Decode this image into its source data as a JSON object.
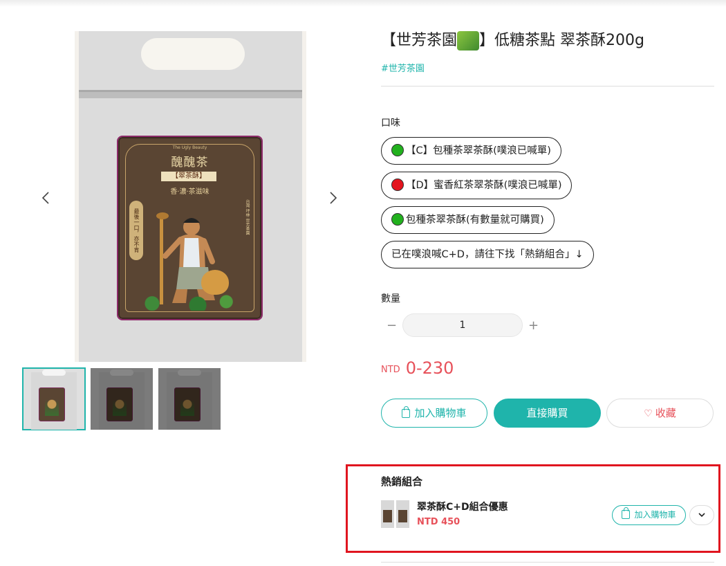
{
  "product": {
    "title_pre": "【世芳茶園",
    "title_post": "】低糖茶點 翠茶酥200g",
    "tag": "#世芳茶園"
  },
  "gallery": {
    "prev_icon": "chevron-left-icon",
    "next_icon": "chevron-right-icon",
    "label": {
      "brand_line": "The Ugly Beauty",
      "name": "醜醜茶",
      "product": "【翠茶酥】",
      "subtitle": "香·濃·茶滋味",
      "left_slogan": "最後一口，亦不肯",
      "right_text": "台灣 坪林 世芳茶園"
    },
    "thumbnails": [
      "thumb-1",
      "thumb-2",
      "thumb-3"
    ]
  },
  "flavor": {
    "label": "口味",
    "options": [
      {
        "text": "【C】包種茶翠茶酥(噗浪已喊單)",
        "dot_color": "#22b11e"
      },
      {
        "text": "【D】蜜香紅茶翠茶酥(噗浪已喊單)",
        "dot_color": "#e4141e"
      },
      {
        "text": "包種茶翠茶酥(有數量就可購買)",
        "dot_color": "#22b11e"
      },
      {
        "text": "已在噗浪喊C+D，請往下找「熱銷組合」↓",
        "dot_color": ""
      }
    ]
  },
  "quantity": {
    "label": "數量",
    "minus": "−",
    "value": "1",
    "plus": "+"
  },
  "price": {
    "currency": "NTD",
    "range": "0-230"
  },
  "actions": {
    "add_to_cart": "加入購物車",
    "buy_now": "直接購買",
    "favorite": "收藏"
  },
  "bundle": {
    "title": "熱銷組合",
    "name": "翠茶酥C+D組合優惠",
    "price": "NTD 450",
    "add_to_cart": "加入購物車",
    "toggle_icon": "chevron-down-icon"
  },
  "colors": {
    "accent": "#1fb4ab",
    "price": "#e7515a",
    "highlight_border": "#e0151f"
  }
}
